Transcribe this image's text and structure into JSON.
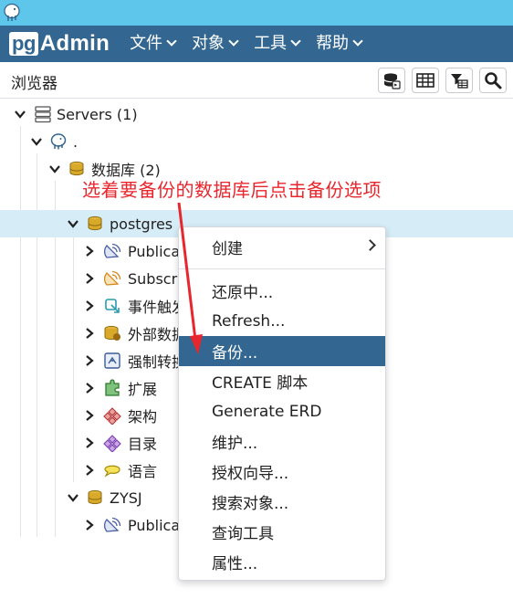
{
  "navbar": {
    "logo_pg": "pg",
    "logo_admin": "Admin",
    "menus": [
      "文件",
      "对象",
      "工具",
      "帮助"
    ]
  },
  "browser": {
    "title": "浏览器",
    "tools": [
      "database-query-icon",
      "grid-icon",
      "filter-table-icon",
      "search-icon"
    ]
  },
  "tree": {
    "servers": "Servers (1)",
    "server": ".",
    "databases": "数据库 (2)",
    "postgres": "postgres",
    "children": [
      "Publicati",
      "Subscri",
      "事件触发",
      "外部数据",
      "强制转换",
      "扩展",
      "架构",
      "目录",
      "语言"
    ],
    "zysj": "ZYSJ",
    "zysj_child": "Publicati"
  },
  "annotation": "选着要备份的数据库后点击备份选项",
  "context_menu": {
    "items": [
      "创建",
      "还原中...",
      "Refresh...",
      "备份...",
      "CREATE 脚本",
      "Generate ERD",
      "维护...",
      "授权向导...",
      "搜索对象...",
      "查询工具",
      "属性..."
    ],
    "active": "备份..."
  },
  "colors": {
    "titlebar": "#5ec6ea",
    "navbar": "#336791",
    "selected_row": "#d6ecf7",
    "annotation": "#e8262d"
  }
}
